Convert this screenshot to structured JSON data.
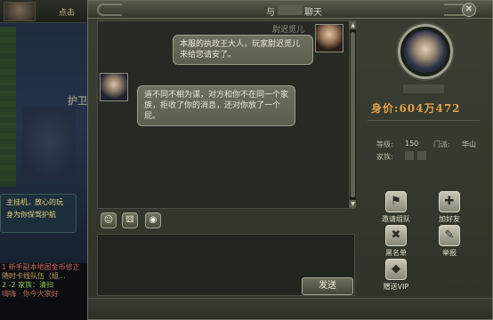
{
  "background": {
    "topbar_label": "点击",
    "map_label": "护卫",
    "task_lines": [
      "主挂机，放心的玩",
      "身为你保驾护航"
    ],
    "chat_lines": [
      {
        "text": "1 新手副本地图金币修正",
        "color": "#c26a5a"
      },
      {
        "text": "随时卡线队伍（组...",
        "color": "#c2a55a"
      },
      {
        "text": "2 -2 家族：清扫",
        "color": "#8fc25a"
      },
      {
        "text": "嗨嗨 · 你今大家好",
        "color": "#c26a5a"
      }
    ]
  },
  "window": {
    "title_prefix": "与",
    "title_name": "",
    "title_suffix": "聊天",
    "close_label": "✕"
  },
  "chat": {
    "sender_name": "尉迟觅儿",
    "messages": [
      {
        "side": "right",
        "text": "本服的执政王大人，玩家尉迟觅儿来给您请安了。"
      },
      {
        "side": "left",
        "text": "道不同不相为谋，对方和你不在同一个家族，拒收了你的消息，还对你放了一个屁。"
      }
    ]
  },
  "toolbar": {
    "emoji_icon": "☺",
    "dice_icon": "⚄",
    "location_icon": "◉"
  },
  "input": {
    "value": "",
    "send_label": "发送"
  },
  "profile": {
    "price_label": "身价:",
    "price_value": "604万472",
    "level_label": "等级:",
    "level_value": "150",
    "sect_label": "门派:",
    "sect_value": "华山",
    "family_label": "家族:",
    "actions": [
      {
        "name": "invite-team",
        "label": "邀请组队",
        "icon": "⚑"
      },
      {
        "name": "add-friend",
        "label": "加好友",
        "icon": "✚"
      },
      {
        "name": "blacklist",
        "label": "黑名单",
        "icon": "✖"
      },
      {
        "name": "report",
        "label": "举报",
        "icon": "✎"
      },
      {
        "name": "gift-vip",
        "label": "赠送VIP",
        "icon": "◆"
      }
    ]
  }
}
